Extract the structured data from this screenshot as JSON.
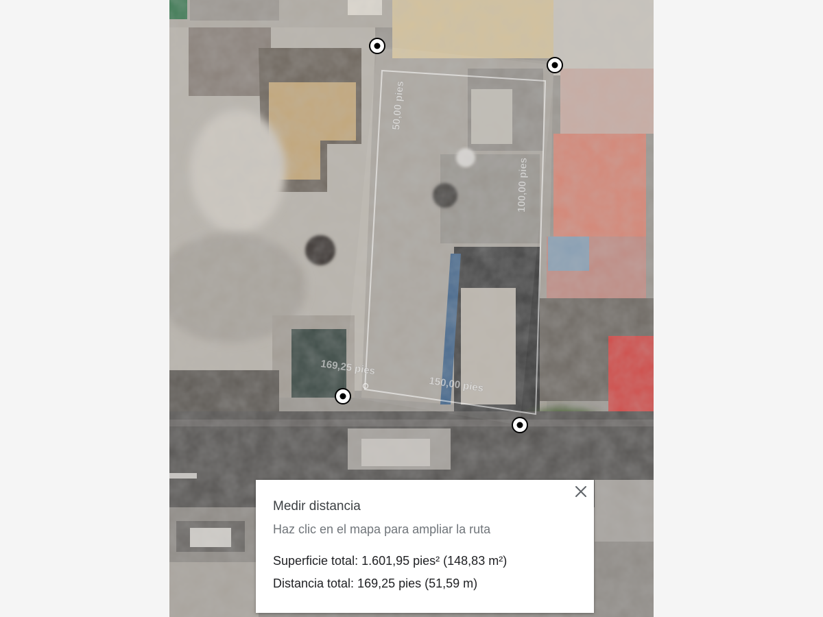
{
  "map": {
    "imagery": "satellite-rooftops",
    "measurement": {
      "path_color": "#ffffff",
      "vertex_fill": "#ffffff",
      "vertex_ring": "#000000",
      "segments": [
        {
          "label": "50,00 pies"
        },
        {
          "label": "100,00 pies"
        },
        {
          "label": "150,00 pies"
        },
        {
          "label": "169,25 pies"
        }
      ],
      "vertices": [
        "vertex-1",
        "vertex-2",
        "vertex-3",
        "vertex-4"
      ]
    }
  },
  "panel": {
    "title": "Medir distancia",
    "hint": "Haz clic en el mapa para ampliar la ruta",
    "area": "Superficie total: 1.601,95 pies² (148,83 m²)",
    "distance": "Distancia total: 169,25 pies (51,59 m)",
    "close_icon": "close-icon"
  }
}
